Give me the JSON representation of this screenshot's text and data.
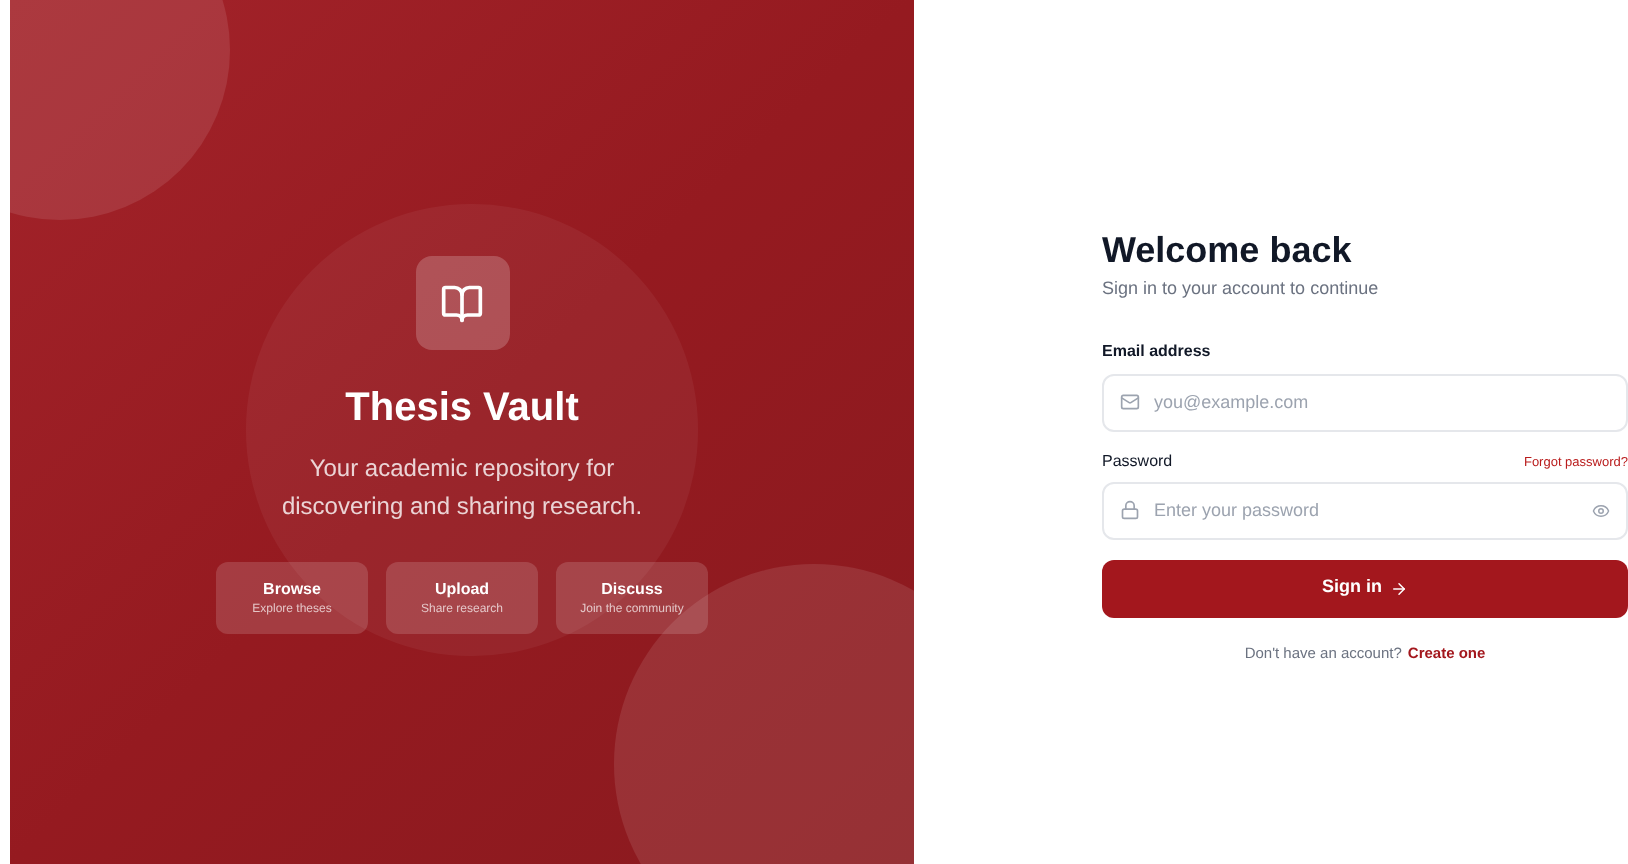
{
  "brand": {
    "title": "Thesis Vault",
    "tagline": "Your academic repository for discovering and sharing research."
  },
  "features": [
    {
      "title": "Browse",
      "subtitle": "Explore theses"
    },
    {
      "title": "Upload",
      "subtitle": "Share research"
    },
    {
      "title": "Discuss",
      "subtitle": "Join the community"
    }
  ],
  "form": {
    "title": "Welcome back",
    "subtitle": "Sign in to your account to continue",
    "email": {
      "label": "Email address",
      "placeholder": "you@example.com"
    },
    "password": {
      "label": "Password",
      "placeholder": "Enter your password",
      "forgot_link": "Forgot password?"
    },
    "submit": "Sign in",
    "footer_text": "Don't have an account?",
    "footer_link": "Create one"
  }
}
